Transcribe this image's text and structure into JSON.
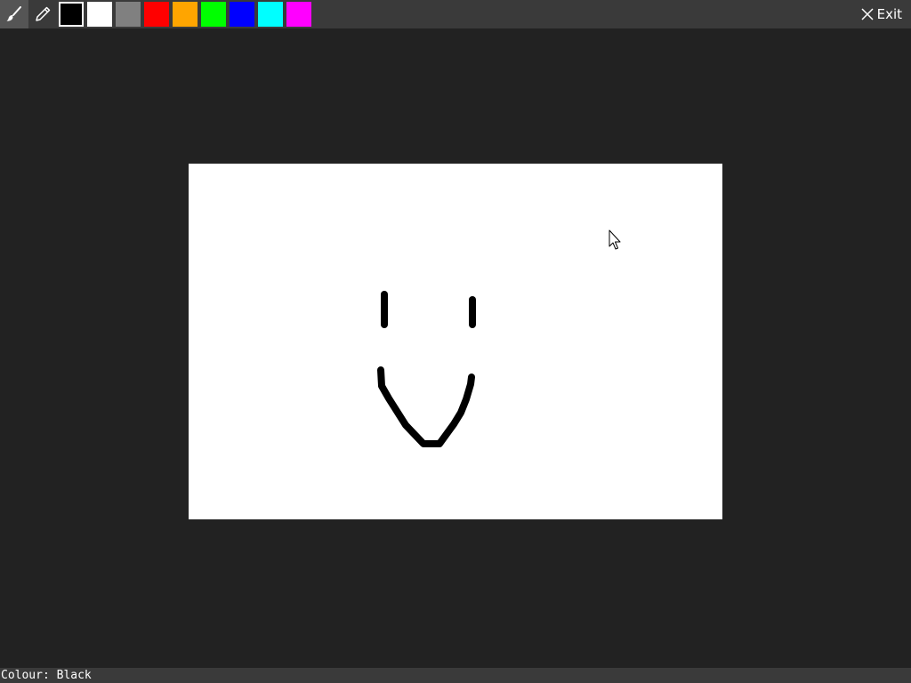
{
  "toolbar": {
    "tools": [
      {
        "icon": "brush-icon",
        "active": true
      },
      {
        "icon": "pencil-icon",
        "active": false
      }
    ],
    "palette": [
      {
        "name": "black-swatch",
        "color": "#000000",
        "selected": true
      },
      {
        "name": "white-swatch",
        "color": "#ffffff",
        "selected": false
      },
      {
        "name": "gray-swatch",
        "color": "#808080",
        "selected": false
      },
      {
        "name": "red-swatch",
        "color": "#ff0000",
        "selected": false
      },
      {
        "name": "orange-swatch",
        "color": "#ffa500",
        "selected": false
      },
      {
        "name": "green-swatch",
        "color": "#00ff00",
        "selected": false
      },
      {
        "name": "blue-swatch",
        "color": "#0000ff",
        "selected": false
      },
      {
        "name": "cyan-swatch",
        "color": "#00ffff",
        "selected": false
      },
      {
        "name": "magenta-swatch",
        "color": "#ff00ff",
        "selected": false
      }
    ],
    "exit_label": "Exit"
  },
  "colors": {
    "background": "#222222",
    "toolbar": "#3a3a3a",
    "canvas": "#ffffff",
    "stroke": "#000000"
  },
  "status": {
    "text": "Colour: Black"
  }
}
